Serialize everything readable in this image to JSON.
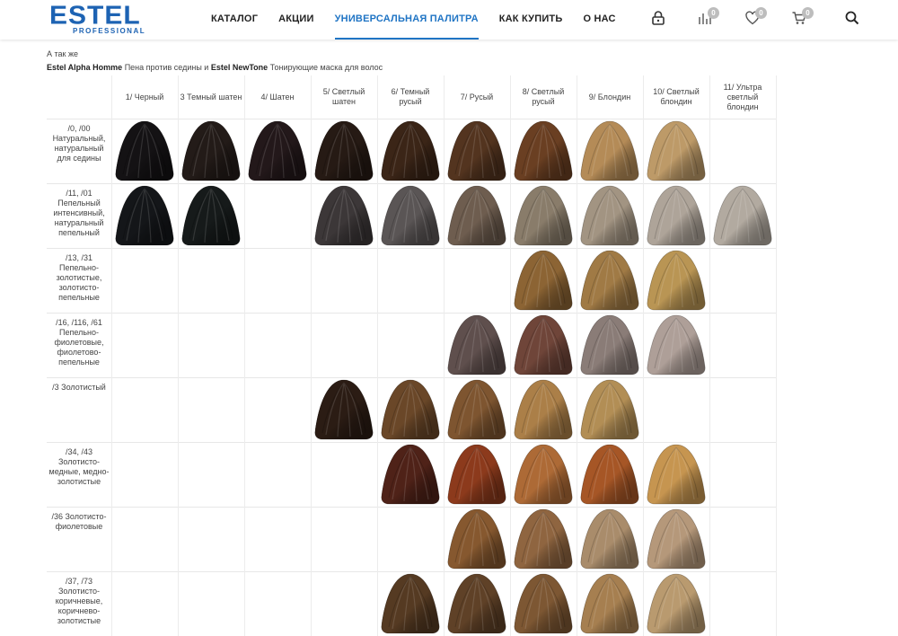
{
  "header": {
    "logo_text": "ESTEL",
    "logo_subtext": "PROFESSIONAL",
    "brand_color": "#1d63b3",
    "accent_color": "#1f74c4",
    "nav": [
      {
        "label": "КАТАЛОГ"
      },
      {
        "label": "АКЦИИ"
      },
      {
        "label": "УНИВЕРСАЛЬНАЯ ПАЛИТРА",
        "active": true
      },
      {
        "label": "КАК КУПИТЬ"
      },
      {
        "label": "О НАС"
      }
    ],
    "icons": [
      {
        "name": "lock-icon"
      },
      {
        "name": "compare-icon",
        "badge": "0"
      },
      {
        "name": "heart-icon",
        "badge": "0"
      },
      {
        "name": "cart-icon",
        "badge": "0"
      },
      {
        "name": "search-icon"
      }
    ]
  },
  "intro": {
    "also_text": "А так же",
    "product1_name": "Estel Alpha Homme",
    "product1_desc": " Пена против седины и ",
    "product2_name": "Estel NewTone",
    "product2_desc": " Тонирующие маска для волос"
  },
  "palette": {
    "columns": [
      "1/ Черный",
      "3 Темный шатен",
      "4/ Шатен",
      "5/ Светлый шатен",
      "6/ Темный русый",
      "7/ Русый",
      "8/ Светлый русый",
      "9/ Блондин",
      "10/ Светлый блондин",
      "11/ Ультра светлый блондин"
    ],
    "rows": [
      {
        "label": "/0, /00 Натуральный, натуральный для седины",
        "colors": [
          "#141214",
          "#231b18",
          "#23181a",
          "#261a14",
          "#3b2517",
          "#53341f",
          "#6a3f22",
          "#b48b57",
          "#bd9a68",
          null
        ]
      },
      {
        "label": "/11, /01 Пепельный интенсивный, натуральный пепельный",
        "colors": [
          "#141619",
          "#161a1a",
          null,
          "#3c3738",
          "#5a5555",
          "#6e5d4f",
          "#897c6a",
          "#a29482",
          "#aea499",
          "#b2aaa0"
        ]
      },
      {
        "label": "/13, /31 Пепельно-золотистые, золотисто-пепельные",
        "colors": [
          null,
          null,
          null,
          null,
          null,
          null,
          "#8c6434",
          "#a07a45",
          "#b99554",
          null
        ]
      },
      {
        "label": "/16, /116, /61 Пепельно-фиолетовые, фиолетово-пепельные",
        "colors": [
          null,
          null,
          null,
          null,
          null,
          "#5f4f4d",
          "#6f4539",
          "#8a7c77",
          "#ae9f98",
          null
        ]
      },
      {
        "label": "/3 Золотистый",
        "colors": [
          null,
          null,
          null,
          "#2b1c14",
          "#6a4728",
          "#7e5530",
          "#ab7f48",
          "#b28e55",
          null,
          null
        ]
      },
      {
        "label": "/34, /43 Золотисто-медные, медно-золотистые",
        "colors": [
          null,
          null,
          null,
          null,
          "#4f2218",
          "#8c3a1c",
          "#ad6a36",
          "#a65626",
          "#c69550",
          null
        ]
      },
      {
        "label": "/36 Золотисто-фиолетовые",
        "colors": [
          null,
          null,
          null,
          null,
          null,
          "#86582f",
          "#8f6540",
          "#a98c6b",
          "#b5987a",
          null
        ]
      },
      {
        "label": "/37, /73 Золотисто-коричневые, коричнево-золотистые",
        "colors": [
          null,
          null,
          null,
          null,
          "#553a22",
          "#5f4127",
          "#7d5733",
          "#a67f50",
          "#b99a6f",
          null
        ]
      }
    ]
  }
}
